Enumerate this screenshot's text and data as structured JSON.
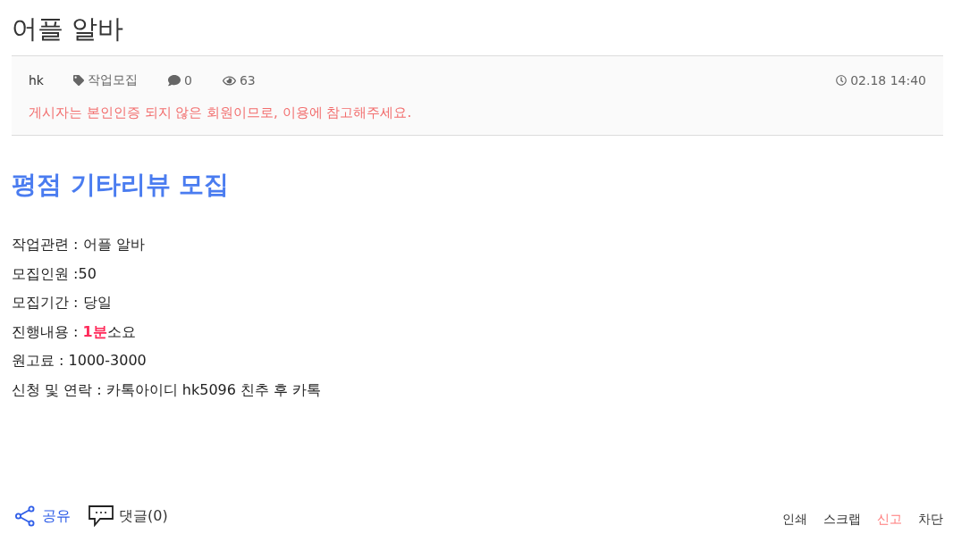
{
  "post": {
    "title": "어플 알바",
    "meta": {
      "author": "hk",
      "category": "작업모집",
      "comments": "0",
      "views": "63",
      "datetime": "02.18 14:40"
    },
    "notice": "게시자는 본인인증 되지 않은 회원이므로, 이용에 참고해주세요."
  },
  "content": {
    "heading": "평점 기타리뷰 모집",
    "lines": [
      "작업관련 : 어플 알바",
      "모집인원 :50",
      "모집기간 : 당일",
      "진행내용 : **1분**소요",
      "원고료 : 1000-3000",
      "신청 및 연락 : 카톡아이디 hk5096 친추 후 카톡"
    ]
  },
  "footer": {
    "share": "공유",
    "comments": "댓글(0)",
    "actions": [
      {
        "label": "인쇄",
        "kind": "plain"
      },
      {
        "label": "스크랩",
        "kind": "plain"
      },
      {
        "label": "신고",
        "kind": "alert"
      },
      {
        "label": "차단",
        "kind": "plain"
      }
    ]
  }
}
